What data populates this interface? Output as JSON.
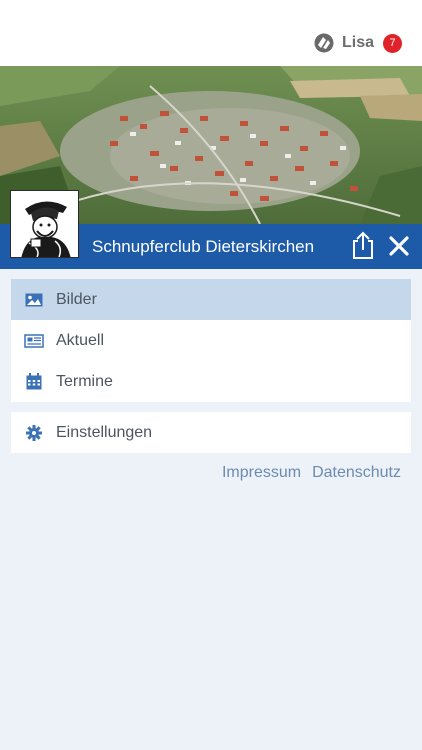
{
  "header": {
    "user_name": "Lisa",
    "notification_count": "7",
    "logo_icon": "app-logo-icon"
  },
  "club": {
    "name": "Schnupferclub Dieterskirchen",
    "share_icon": "share-icon",
    "close_icon": "close-icon"
  },
  "menu": {
    "items": [
      {
        "label": "Bilder",
        "icon": "image-icon",
        "active": true
      },
      {
        "label": "Aktuell",
        "icon": "newspaper-icon",
        "active": false
      },
      {
        "label": "Termine",
        "icon": "calendar-icon",
        "active": false
      }
    ],
    "settings": {
      "label": "Einstellungen",
      "icon": "gear-icon"
    }
  },
  "footer": {
    "impressum": "Impressum",
    "datenschutz": "Datenschutz"
  },
  "colors": {
    "brand_blue": "#1d5aa8",
    "active_item": "#c5d7ea",
    "background": "#edf1f8",
    "badge_red": "#e0232b",
    "link": "#6c8bb1",
    "icon_blue": "#3a72b5"
  }
}
